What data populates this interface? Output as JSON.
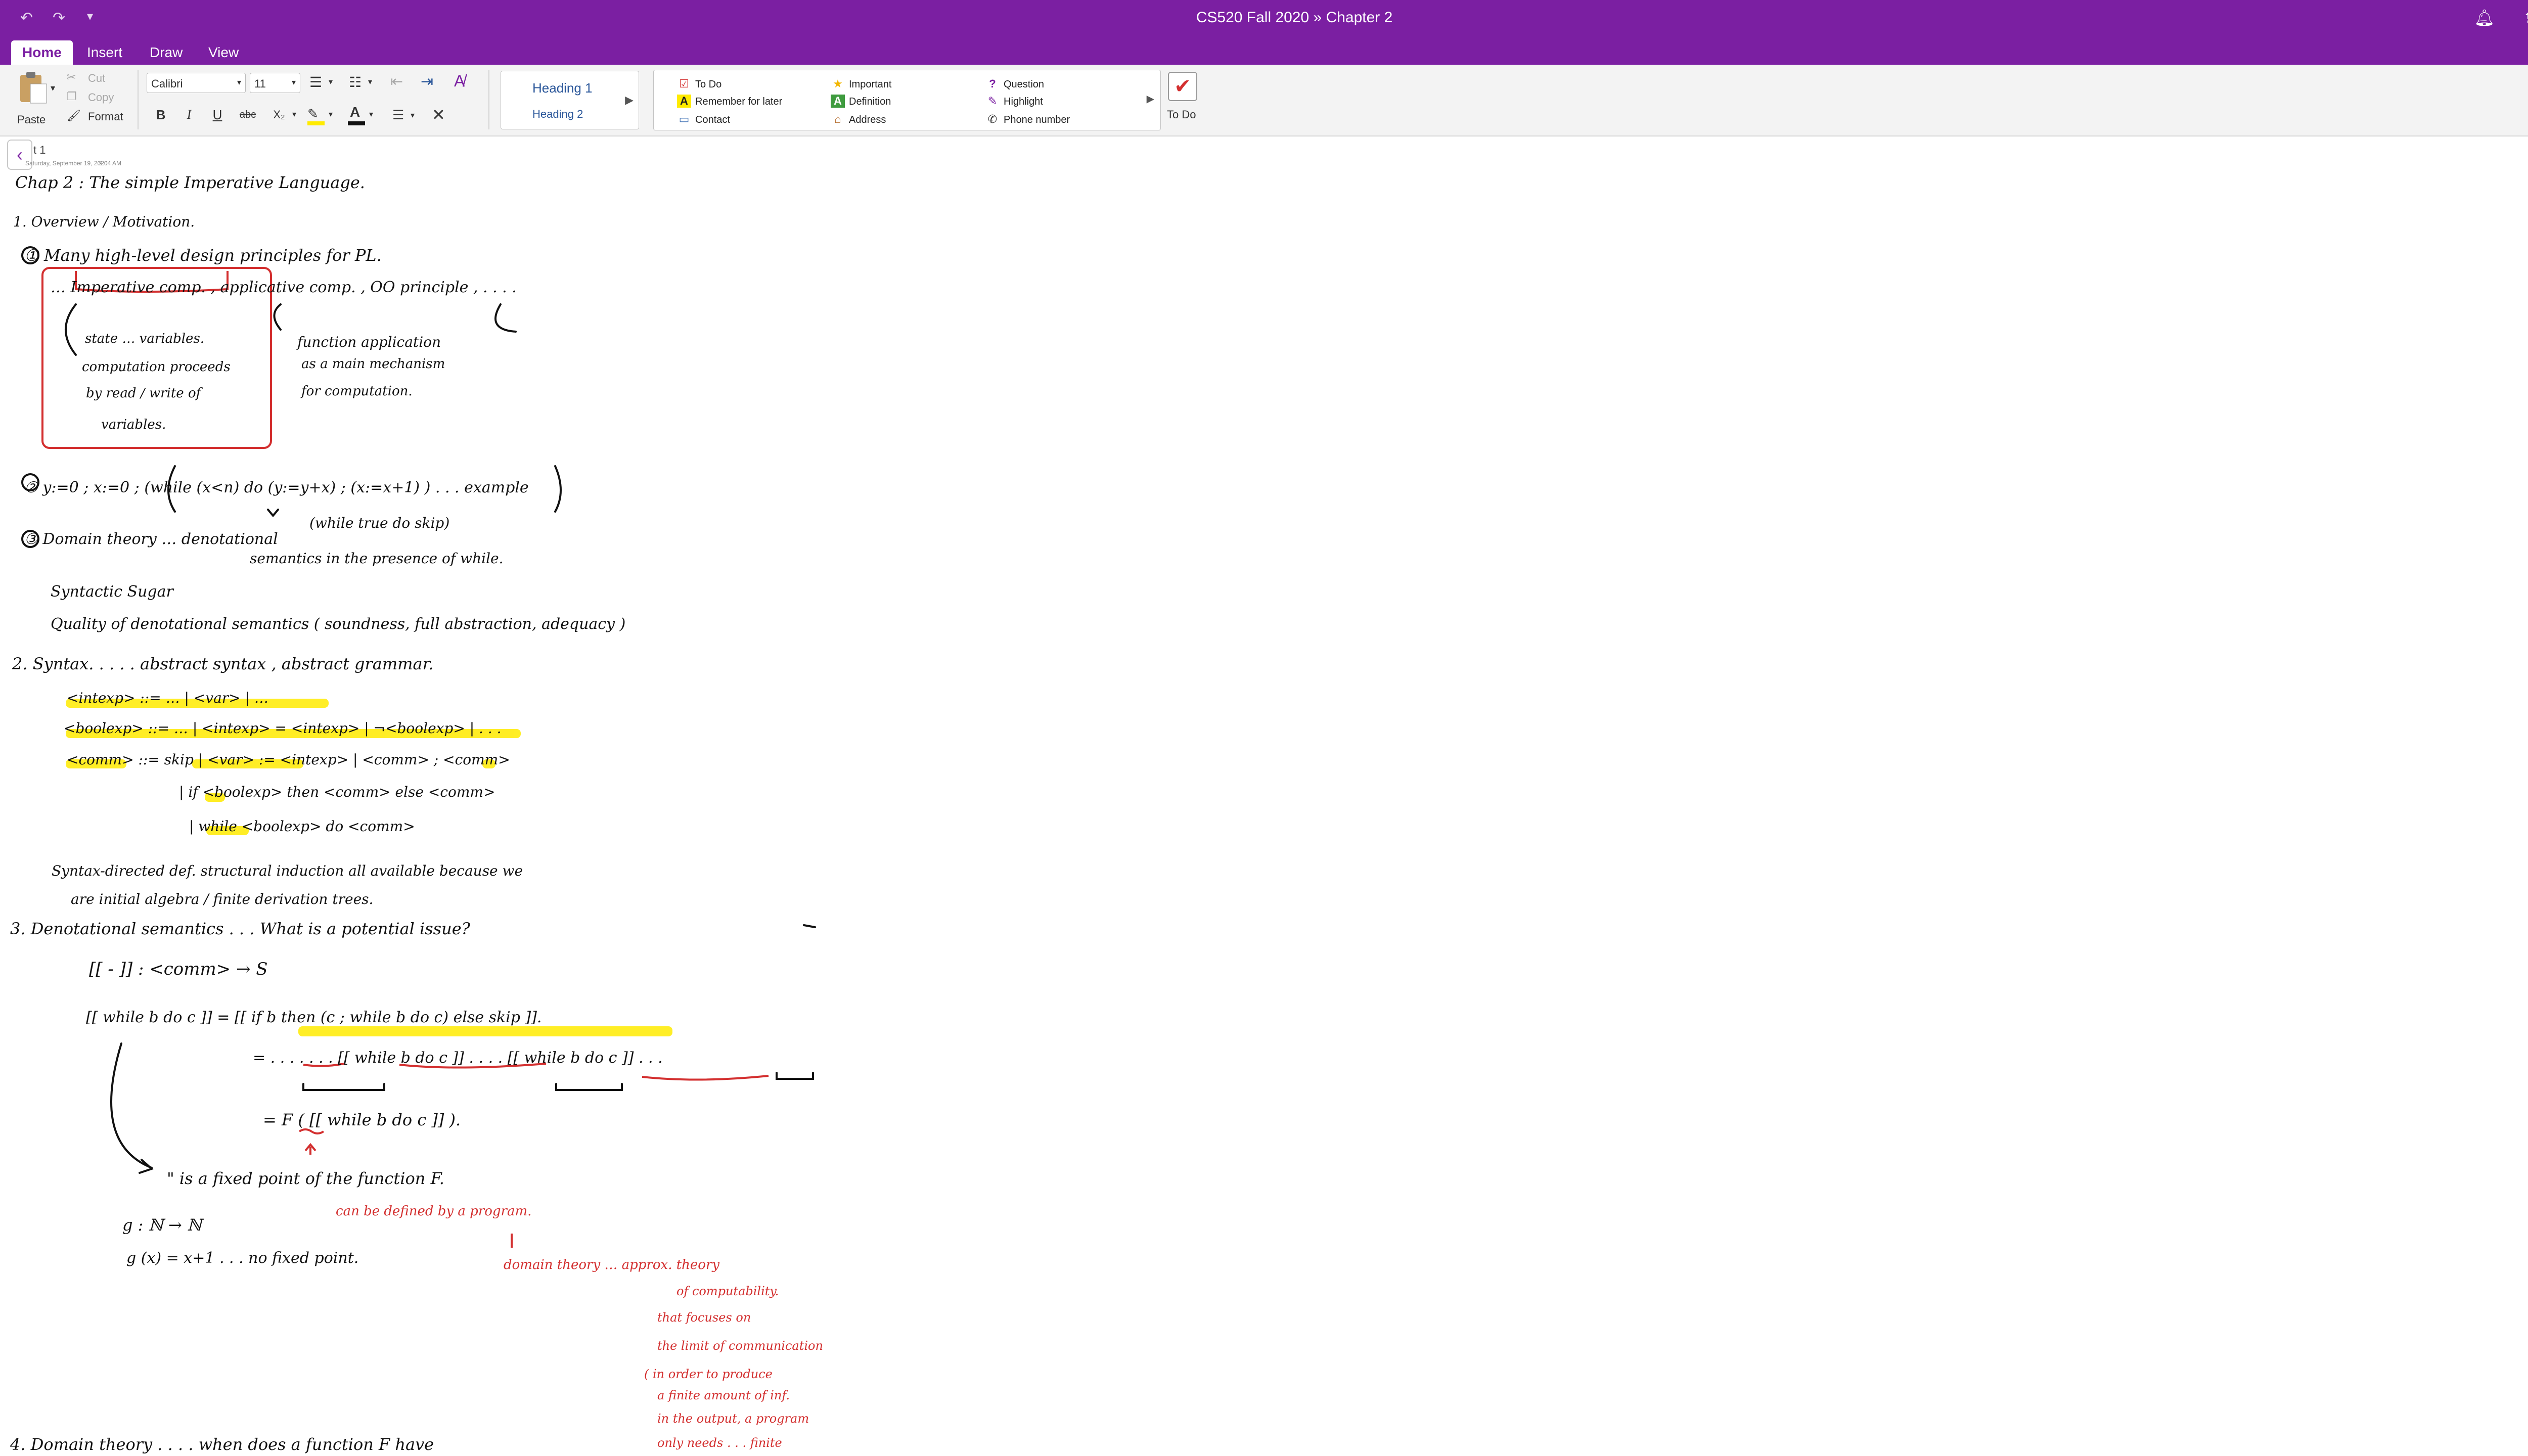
{
  "window": {
    "title": "CS520 Fall 2020  »  Chapter 2"
  },
  "tabs": [
    "Home",
    "Insert",
    "Draw",
    "View"
  ],
  "ribbon": {
    "paste_label": "Paste",
    "cut_label": "Cut",
    "copy_label": "Copy",
    "format_label": "Format",
    "font_name": "Calibri",
    "font_size": "11",
    "bold": "B",
    "italic": "I",
    "underline": "U",
    "strike": "abc",
    "subscript": "X₂",
    "styles": [
      "Heading 1",
      "Heading 2"
    ],
    "tags": [
      {
        "label": "To Do",
        "icon": "checkbox-icon"
      },
      {
        "label": "Remember for later",
        "icon": "highlight-a-icon"
      },
      {
        "label": "Contact",
        "icon": "contact-card-icon"
      },
      {
        "label": "Important",
        "icon": "star-icon"
      },
      {
        "label": "Definition",
        "icon": "definition-a-icon"
      },
      {
        "label": "Address",
        "icon": "house-icon"
      },
      {
        "label": "Question",
        "icon": "question-icon"
      },
      {
        "label": "Highlight",
        "icon": "pen-icon"
      },
      {
        "label": "Phone number",
        "icon": "phone-icon"
      }
    ],
    "todo_big_label": "To Do"
  },
  "page": {
    "title": "t 1",
    "meta_date": "Saturday, September 19, 2020",
    "meta_time": "9:04 AM"
  },
  "notes": {
    "lines": [
      "Chap 2 :   The simple Imperative Language.",
      "1.  Overview / Motivation.",
      "① Many high-level design principles for PL.",
      "… Imperative comp.  ,  applicative comp.  ,  OO principle ,  . . . .",
      "state … variables.",
      "computation proceeds",
      "by  read / write of",
      "variables.",
      "function application",
      "as a main mechanism",
      "for computation.",
      "② y:=0 ; x:=0 ; (while (x<n) do (y:=y+x) ; (x:=x+1) )     . . .  example",
      "(while true do skip)",
      "③ Domain theory … denotational",
      "semantics in the presence of while.",
      "Syntactic Sugar",
      "Quality of denotational semantics   ( soundness, full abstraction, adequacy )",
      "2.  Syntax.     . . . . abstract syntax , abstract grammar.",
      "<intexp> ::= …  | <var> | …",
      "<boolexp> ::= …  | <intexp> = <intexp> | ¬<boolexp> | . . .",
      "<comm>  ::=  skip | <var> := <intexp>  |  <comm> ; <comm>",
      "| if <boolexp> then <comm> else <comm>",
      "| while <boolexp> do <comm>",
      "Syntax-directed def.     structural induction  all  available  because we",
      "are initial algebra / finite derivation trees.",
      "3. Denotational semantics  . . . What is a potential issue?",
      "[[ - ]]   :   <comm>   →   S",
      "[[ while b do c ]]   =   [[ if b then (c ; while b do c) else skip ]].",
      "=    . . . . . . .   [[ while b do c ]] . . . .     [[ while b do c ]] . . .",
      "=   F ( [[ while b do c ]] ).",
      "\"    is  a  fixed point of the function F.",
      "g : ℕ → ℕ",
      "g (x) = x+1        . . . no fixed point.",
      "4. Domain theory      . . . .     when does a function F have"
    ],
    "red_lines": [
      "can be defined by a program.",
      "domain theory … approx. theory",
      "of computability.",
      "that focuses on",
      "the limit of communication",
      "( in order to produce",
      "a finite amount of inf.",
      "in the output, a program",
      "only needs . . . finite"
    ]
  },
  "colors": {
    "brand": "#7b1fa2",
    "highlight": "#ffeb00",
    "red_ink": "#d32f2f"
  }
}
